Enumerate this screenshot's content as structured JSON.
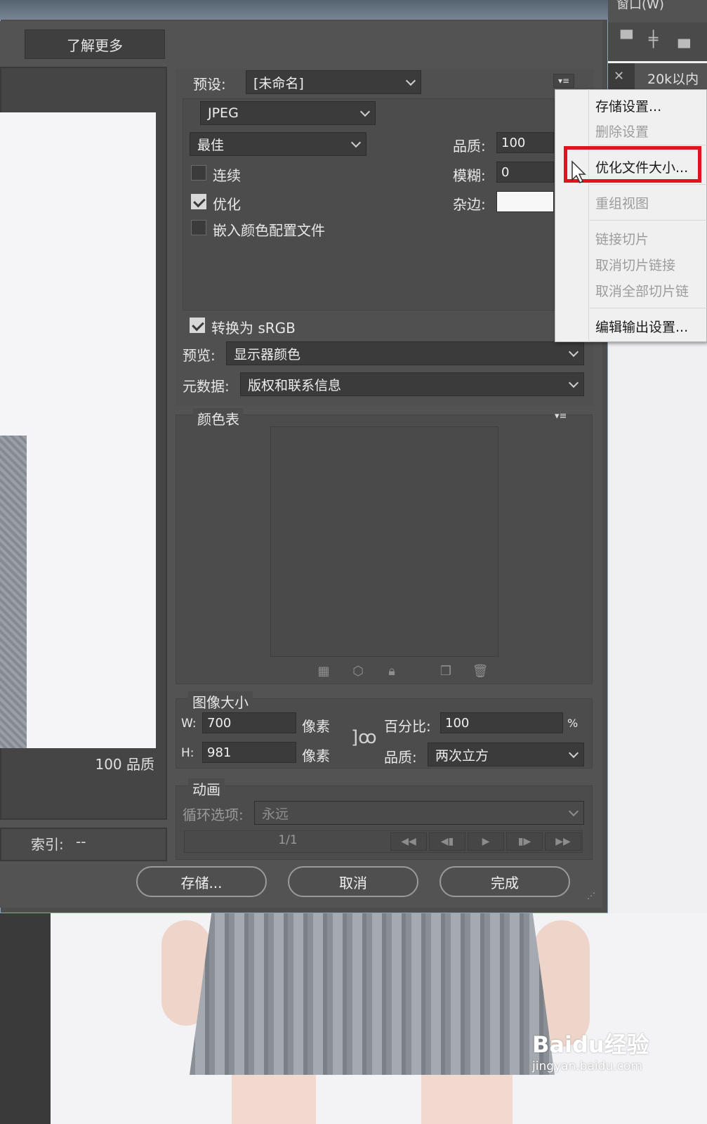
{
  "dialog": {
    "learn_more_label": "了解更多"
  },
  "preview": {
    "quality_note": "100 品质",
    "index_label": "索引:",
    "index_value": "--"
  },
  "settings": {
    "preset_label": "预设:",
    "preset_value": "[未命名]",
    "format_value": "JPEG",
    "quality_level_value": "最佳",
    "quality_label": "品质:",
    "quality_value": "100",
    "blur_label": "模糊:",
    "blur_value": "0",
    "matte_label": "杂边:",
    "progressive_label": "连续",
    "progressive_checked": false,
    "optimized_label": "优化",
    "optimized_checked": true,
    "embed_profile_label": "嵌入颜色配置文件",
    "embed_profile_checked": false,
    "convert_srgb_label": "转换为 sRGB",
    "convert_srgb_checked": true,
    "preview_label": "预览:",
    "preview_value": "显示器颜色",
    "metadata_label": "元数据:",
    "metadata_value": "版权和联系信息"
  },
  "color_table": {
    "title": "颜色表"
  },
  "image_size": {
    "title": "图像大小",
    "w_label": "W:",
    "w_value": "700",
    "h_label": "H:",
    "h_value": "981",
    "unit": "像素",
    "percent_label": "百分比:",
    "percent_value": "100",
    "percent_unit": "%",
    "quality_label": "品质:",
    "quality_value": "两次立方"
  },
  "animation": {
    "title": "动画",
    "loop_label": "循环选项:",
    "loop_value": "永远",
    "frame_counter": "1/1"
  },
  "actions": {
    "save_label": "存储...",
    "cancel_label": "取消",
    "done_label": "完成"
  },
  "menu": {
    "items": [
      {
        "label": "存储设置...",
        "enabled": true
      },
      {
        "label": "删除设置",
        "enabled": false
      },
      {
        "label": "优化文件大小...",
        "enabled": true,
        "highlighted": true
      },
      {
        "label": "重组视图",
        "enabled": false
      },
      {
        "label": "链接切片",
        "enabled": false
      },
      {
        "label": "取消切片链接",
        "enabled": false
      },
      {
        "label": "取消全部切片链",
        "enabled": false
      },
      {
        "label": "编辑输出设置...",
        "enabled": true
      }
    ]
  },
  "ps_panel": {
    "tab_label": "20k以内",
    "menu_label": "窗口(W)"
  },
  "watermark": {
    "logo": "Baidu经验",
    "url": "jingyan.baidu.com"
  },
  "colors": {
    "highlight": "#e0141e",
    "dialog_bg": "#535353",
    "menu_bg": "#f0f0f0"
  }
}
